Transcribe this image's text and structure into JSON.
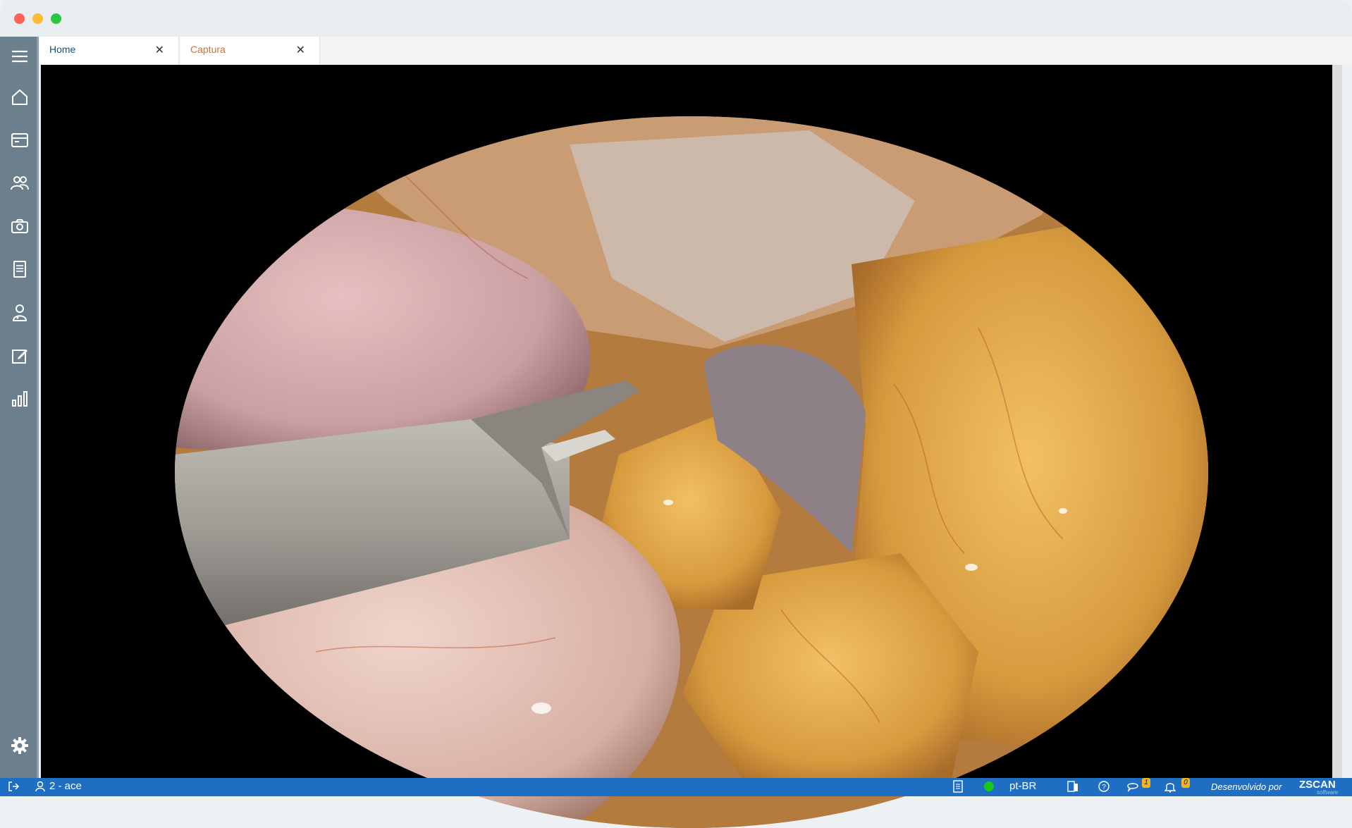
{
  "tabs": [
    {
      "label": "Home",
      "color": "#1c4f74"
    },
    {
      "label": "Captura",
      "color": "#c9733d"
    }
  ],
  "sidebar": {
    "items": [
      {
        "icon": "menu-icon"
      },
      {
        "icon": "home-icon"
      },
      {
        "icon": "schedule-card-icon"
      },
      {
        "icon": "patients-icon"
      },
      {
        "icon": "camera-icon"
      },
      {
        "icon": "report-document-icon"
      },
      {
        "icon": "doctor-icon"
      },
      {
        "icon": "edit-icon"
      },
      {
        "icon": "bar-chart-icon"
      },
      {
        "icon": "settings-gear-icon"
      }
    ]
  },
  "viewer": {
    "content": "laparoscopic surgery video frame"
  },
  "statusbar": {
    "user": "2 - ace",
    "language": "pt-BR",
    "messages_count": "1",
    "notifications_count": "0",
    "developed_by": "Desenvolvido por",
    "brand": "ZSCAN",
    "brand_sub": "software"
  },
  "colors": {
    "statusbar": "#1e6fc4",
    "sidebar": "#6b7f8c",
    "online": "#19c71a"
  }
}
